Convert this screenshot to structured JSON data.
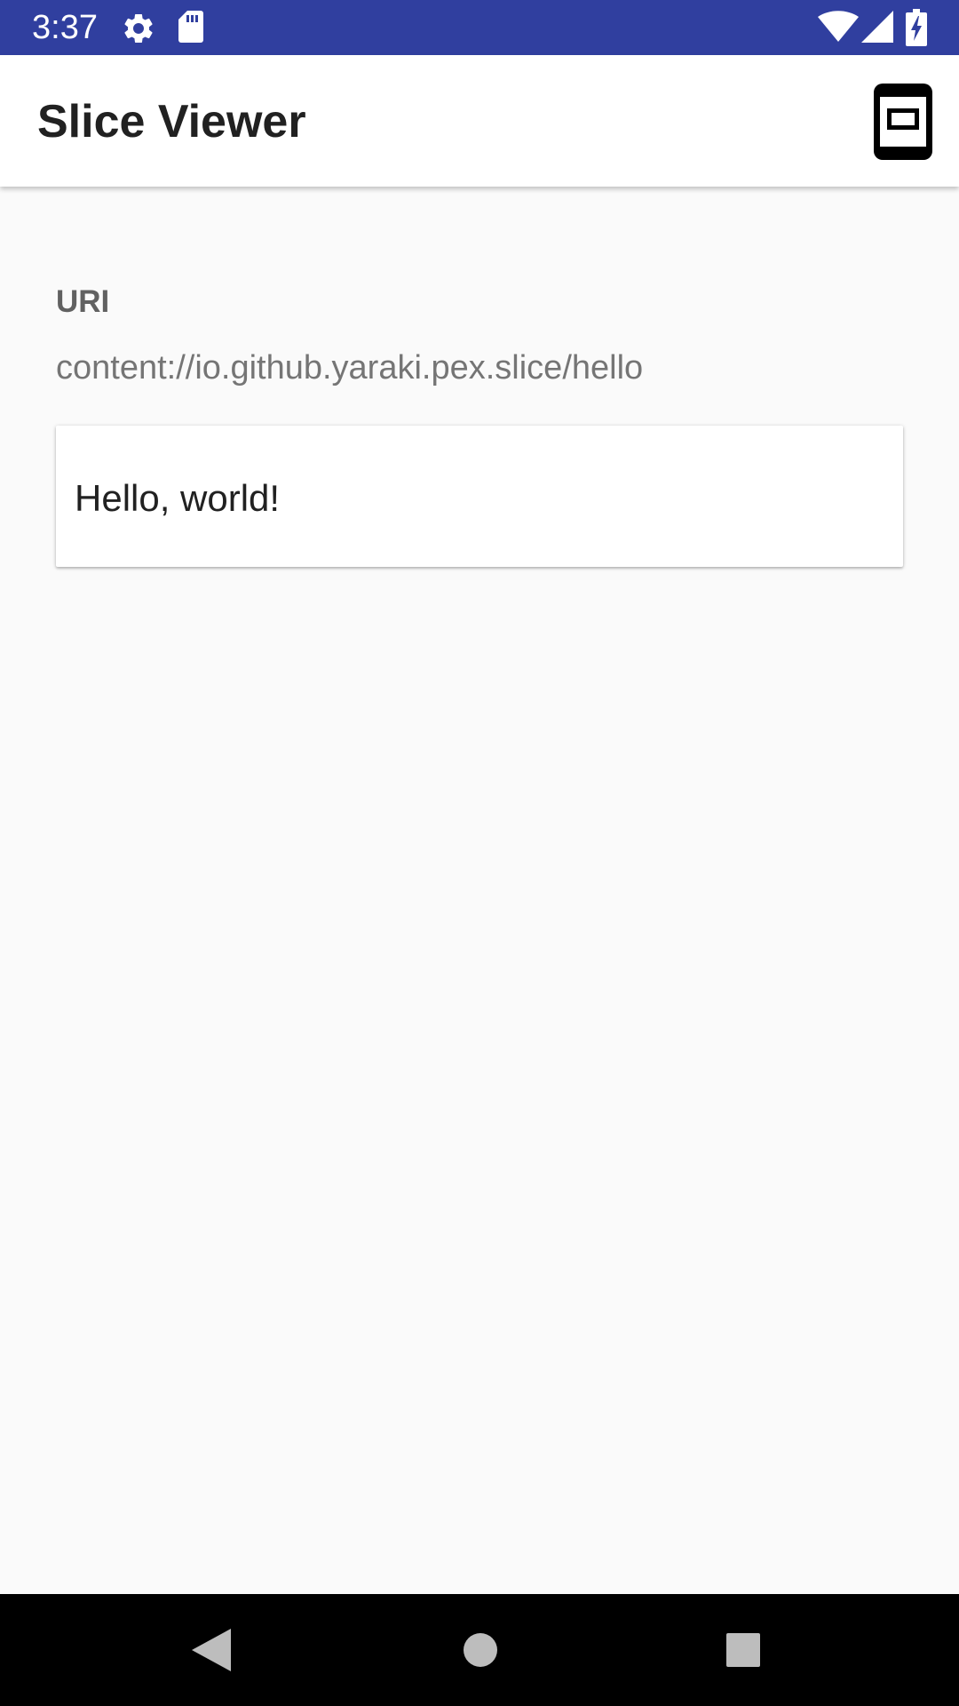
{
  "status_bar": {
    "time": "3:37",
    "bg_color": "#303f9f",
    "icons": [
      "gear-icon",
      "sd-card-icon",
      "wifi-icon",
      "signal-icon",
      "battery-charging-icon"
    ]
  },
  "app_bar": {
    "title": "Slice Viewer",
    "action_icon": "phone-mode-icon"
  },
  "content": {
    "uri_label": "URI",
    "uri_value": "content://io.github.yaraki.pex.slice/hello",
    "slice": {
      "text": "Hello, world!"
    }
  },
  "nav_bar": {
    "buttons": [
      "back-icon",
      "home-icon",
      "recents-icon"
    ]
  }
}
